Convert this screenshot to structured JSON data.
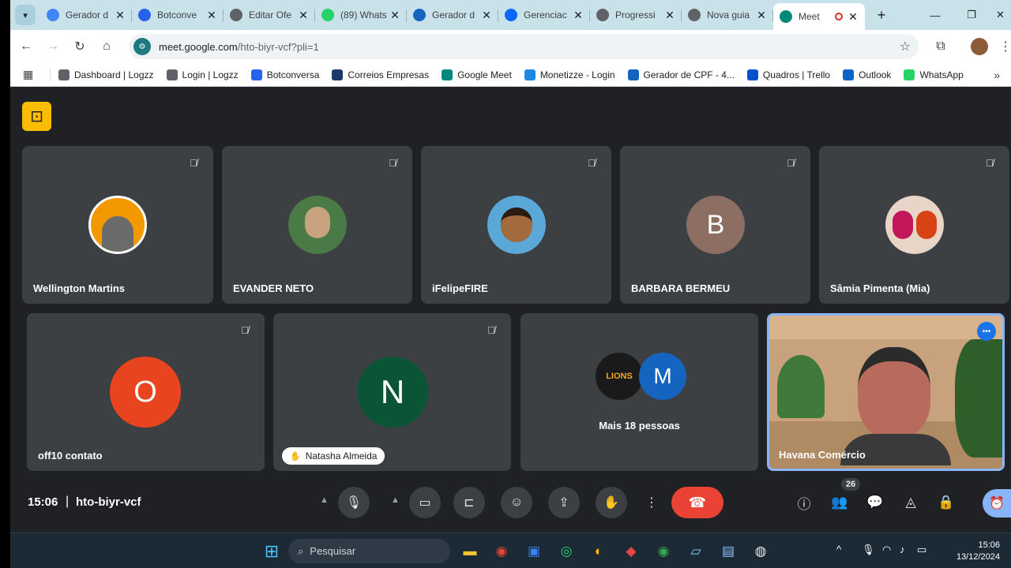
{
  "tabs": [
    {
      "title": "Gerador d",
      "favicon": "globe-blue",
      "active": false
    },
    {
      "title": "Botconve",
      "favicon": "botconversa",
      "active": false
    },
    {
      "title": "Editar Ofe",
      "favicon": "logzz",
      "active": false
    },
    {
      "title": "(89) Whats",
      "favicon": "whatsapp",
      "active": false
    },
    {
      "title": "Gerador d",
      "favicon": "gerador-s",
      "active": false
    },
    {
      "title": "Gerenciac",
      "favicon": "meta",
      "active": false
    },
    {
      "title": "Progressi",
      "favicon": "logzz",
      "active": false
    },
    {
      "title": "Nova guia",
      "favicon": "globe",
      "active": false
    },
    {
      "title": "Meet",
      "favicon": "meet",
      "active": true
    }
  ],
  "address": {
    "host": "meet.google.com",
    "path": "/hto-biyr-vcf?pli=1"
  },
  "bookmarks": [
    {
      "label": "Dashboard | Logzz",
      "icon": "logzz",
      "color": "#5f6368"
    },
    {
      "label": "Login | Logzz",
      "icon": "logzz",
      "color": "#5f6368"
    },
    {
      "label": "Botconversa",
      "icon": "botconversa",
      "color": "#2563eb"
    },
    {
      "label": "Correios Empresas",
      "icon": "correios",
      "color": "#1a3a6b"
    },
    {
      "label": "Google Meet",
      "icon": "meet",
      "color": "#00897b"
    },
    {
      "label": "Monetizze - Login",
      "icon": "monetizze",
      "color": "#1e88e5"
    },
    {
      "label": "Gerador de CPF - 4...",
      "icon": "gerador",
      "color": "#1565c0"
    },
    {
      "label": "Quadros | Trello",
      "icon": "trello",
      "color": "#0052cc"
    },
    {
      "label": "Outlook",
      "icon": "outlook",
      "color": "#0a64c8"
    },
    {
      "label": "WhatsApp",
      "icon": "whatsapp",
      "color": "#25d366"
    }
  ],
  "participants_row1": [
    {
      "name": "Wellington Martins",
      "avatar": "photo",
      "color": "#f29900",
      "muted": true
    },
    {
      "name": "EVANDER NETO",
      "avatar": "photo",
      "color": "#4a7a46",
      "muted": true
    },
    {
      "name": "iFelipeFIRE",
      "avatar": "photo",
      "color": "#5aa8d8",
      "muted": true
    },
    {
      "name": "BARBARA BERMEU",
      "avatar": "letter",
      "initial": "B",
      "color": "#8d6e63",
      "muted": true
    },
    {
      "name": "Sâmia Pimenta (Mia)",
      "avatar": "photo",
      "color": "#c2185b",
      "muted": true
    }
  ],
  "participants_row2": [
    {
      "name": "off10 contato",
      "avatar": "letter",
      "initial": "O",
      "color": "#e8441f",
      "muted": true
    },
    {
      "name": "Natasha Almeida",
      "avatar": "letter",
      "initial": "N",
      "color": "#0b5436",
      "muted": true
    }
  ],
  "more_tile": {
    "label": "Mais 18 pessoas",
    "initial": "M",
    "color": "#1565c0",
    "logo_text": "LIONS"
  },
  "active_speaker": {
    "name": "Havana Comércio"
  },
  "controls": {
    "time": "15:06",
    "meeting_code": "hto-biyr-vcf",
    "people_count": "26"
  },
  "taskbar": {
    "search_placeholder": "Pesquisar",
    "time": "15:06",
    "date": "13/12/2024"
  }
}
